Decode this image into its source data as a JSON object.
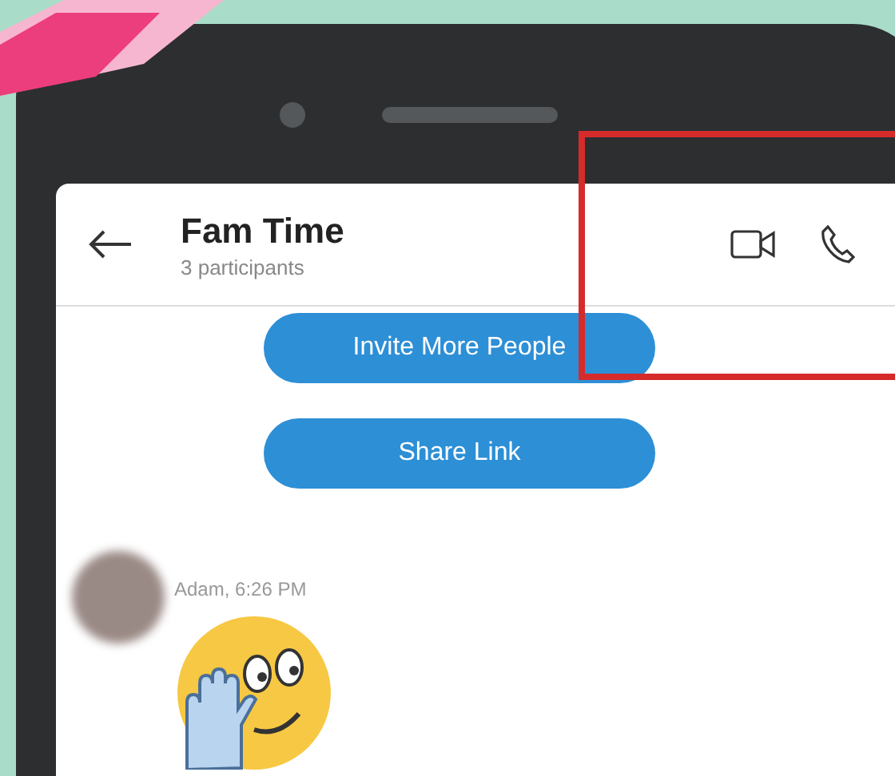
{
  "chat": {
    "title": "Fam Time",
    "subtitle": "3 participants"
  },
  "actions": [
    {
      "label": "Invite More People"
    },
    {
      "label": "Share Link"
    }
  ],
  "message": {
    "sender_time": "Adam, 6:26 PM"
  }
}
